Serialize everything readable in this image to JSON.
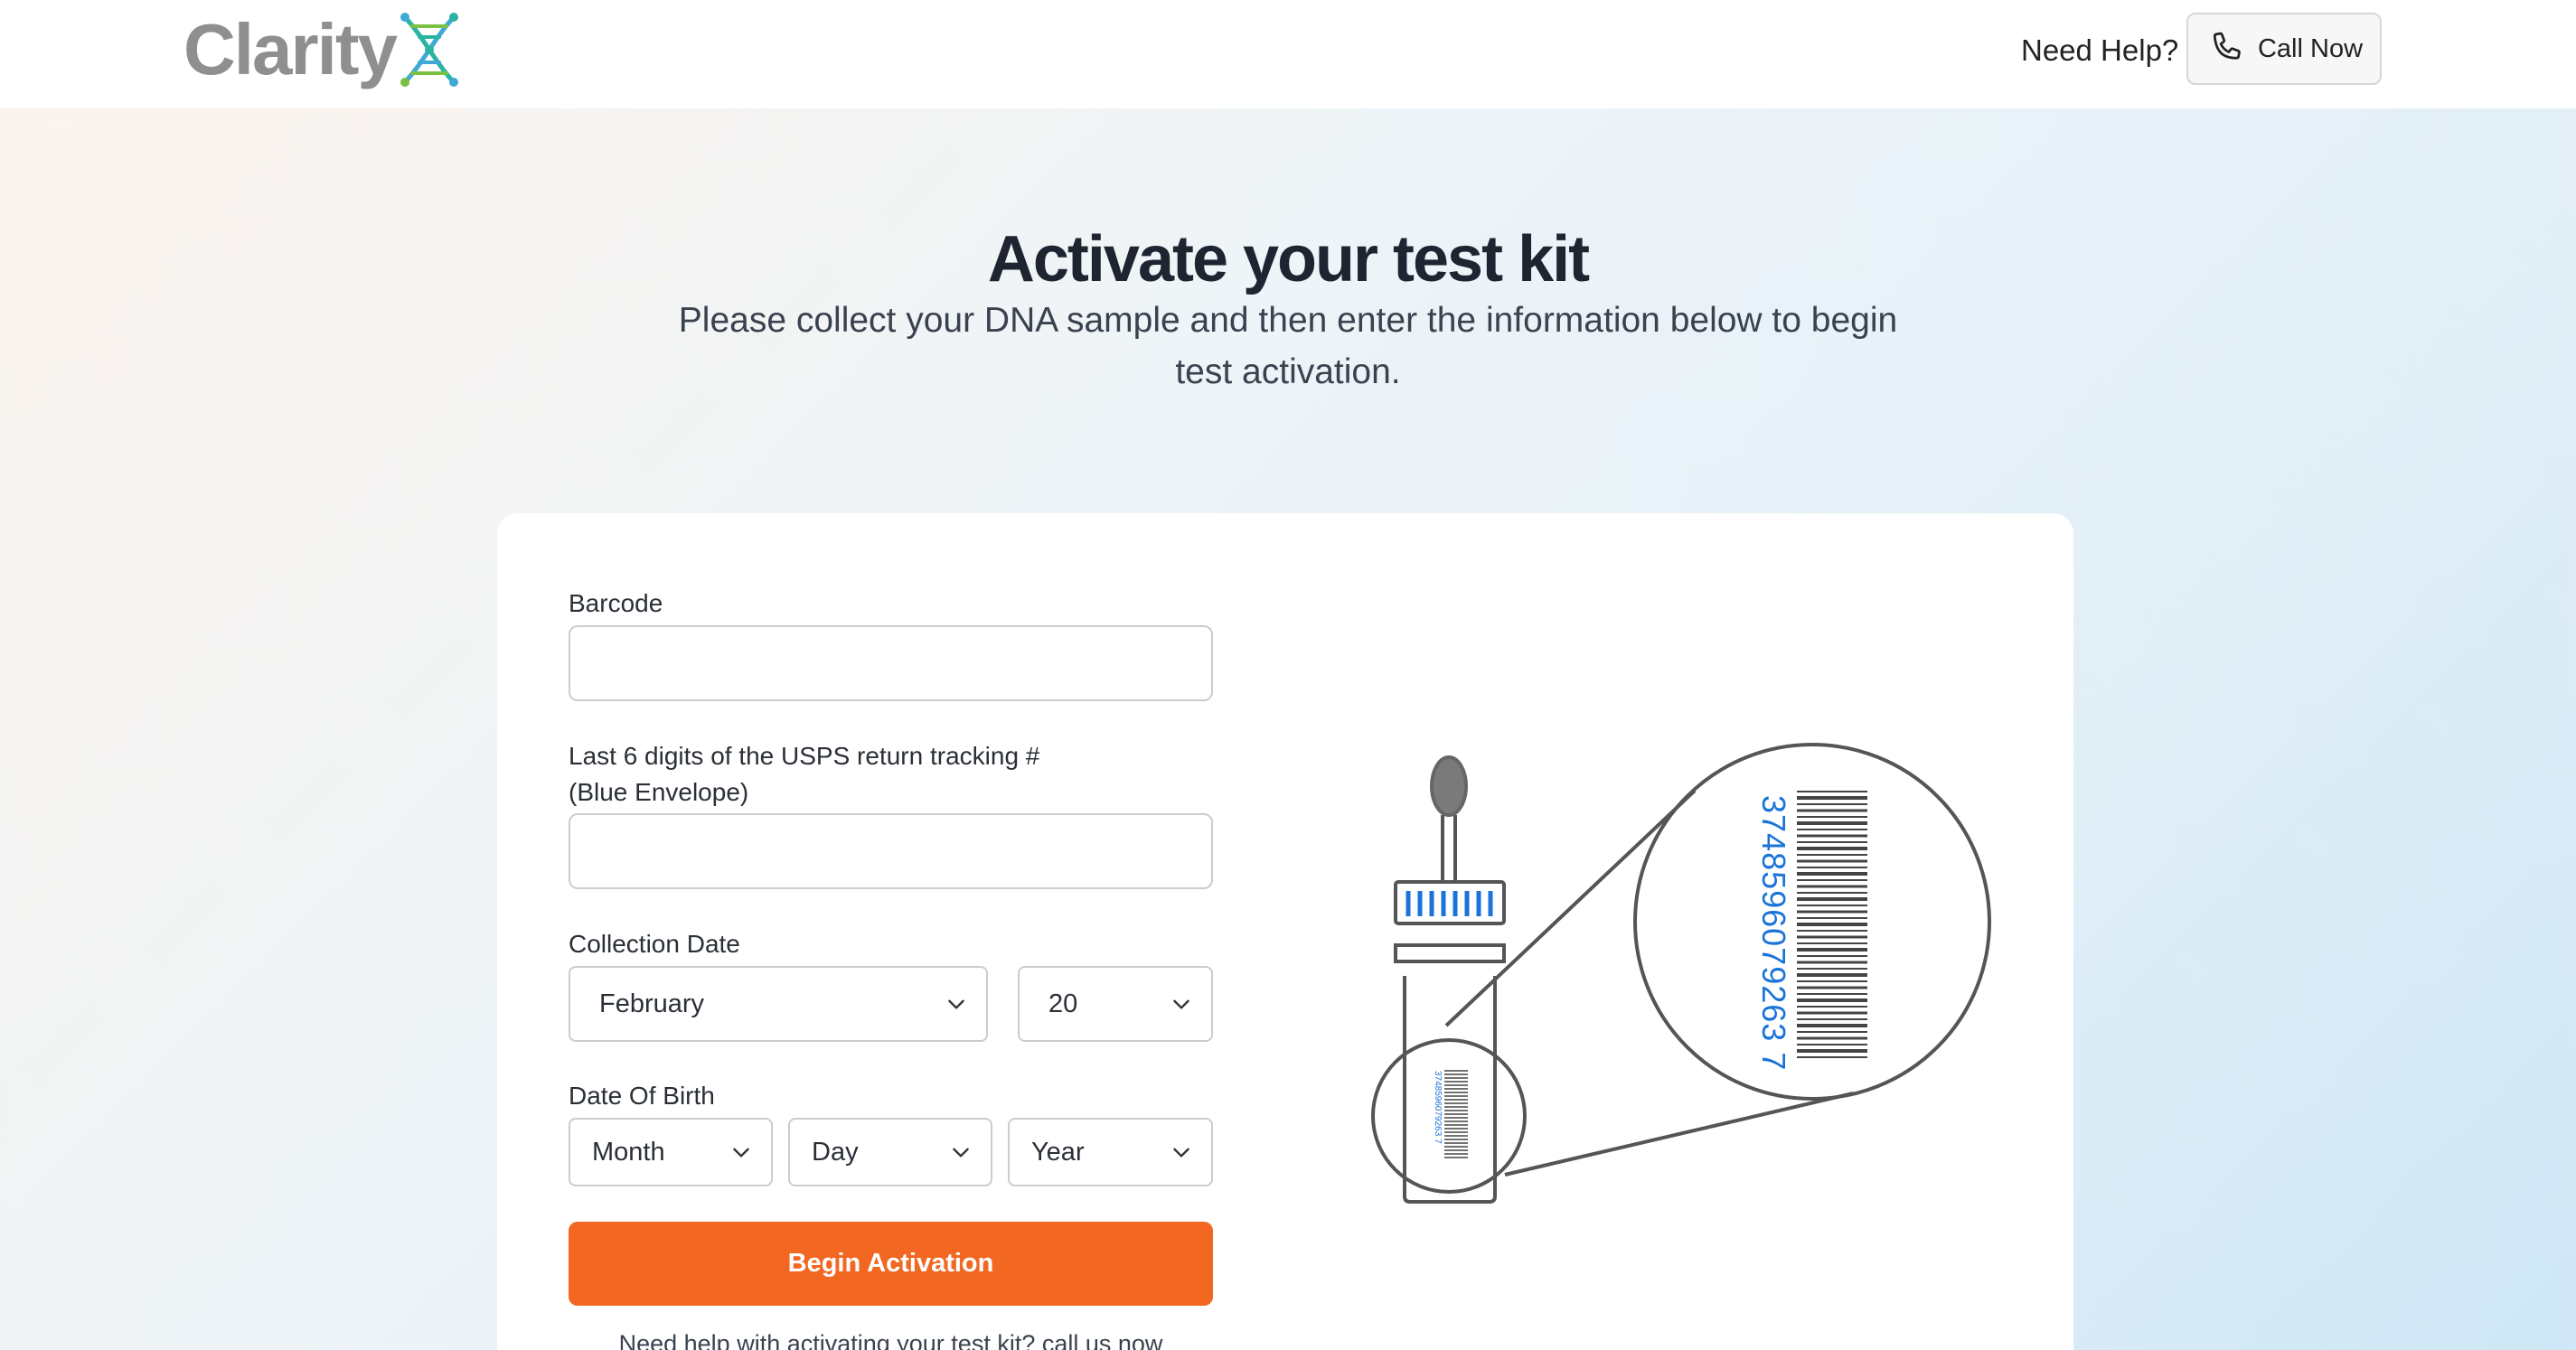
{
  "header": {
    "logo_text": "Clarity",
    "help_text": "Need Help?",
    "call_button_label": "Call Now"
  },
  "hero": {
    "title": "Activate your test kit",
    "subtitle": "Please collect your DNA sample and then enter the information below to begin test activation."
  },
  "form": {
    "barcode": {
      "label": "Barcode",
      "value": ""
    },
    "tracking": {
      "label_line1": "Last 6 digits of the USPS return tracking #",
      "label_line2": "(Blue Envelope)",
      "value": ""
    },
    "collection_date": {
      "label": "Collection Date",
      "month": "February",
      "day": "20"
    },
    "date_of_birth": {
      "label": "Date Of Birth",
      "month": "Month",
      "day": "Day",
      "year": "Year"
    },
    "submit_label": "Begin Activation",
    "help_text": "Need help with activating your test kit? call us now"
  },
  "illustration": {
    "barcode_number": "3748596079263 7"
  },
  "colors": {
    "accent": "#f26722",
    "barcode_blue": "#1a73d9",
    "logo_gray": "#8f8f8f"
  },
  "icons": [
    "dna-x-logo-icon",
    "phone-icon",
    "chevron-down-icon"
  ]
}
